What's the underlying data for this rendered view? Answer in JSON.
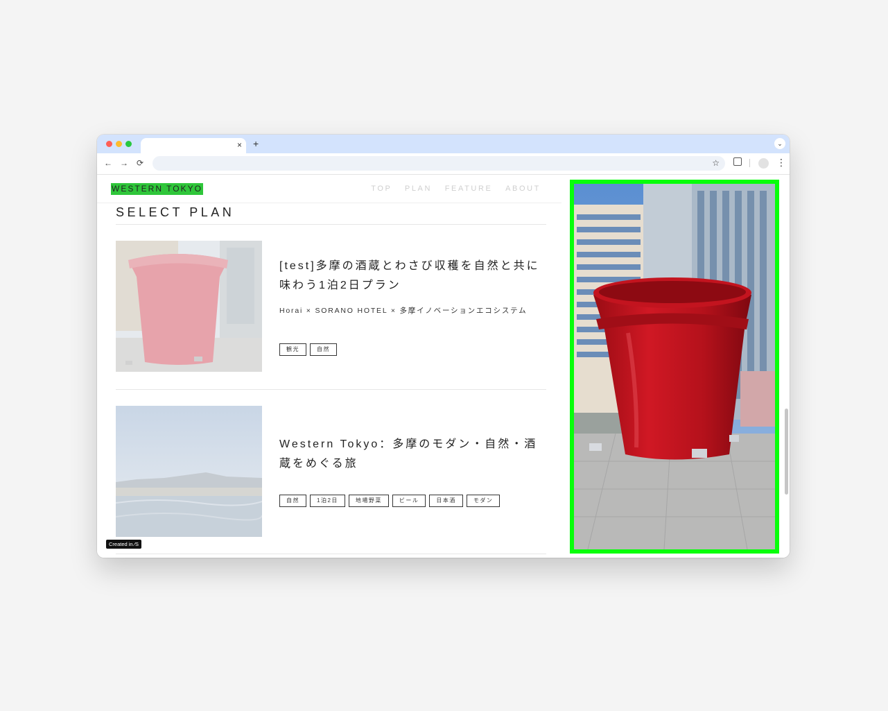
{
  "browser": {
    "tab_close": "×",
    "new_tab": "+",
    "search_tabs": "⌄",
    "back": "←",
    "forward": "→",
    "reload": "⟳",
    "bookmark": "☆",
    "menu": "⋮"
  },
  "site": {
    "logo": "WESTERN TOKYO",
    "nav": [
      "TOP",
      "PLAN",
      "FEATURE",
      "ABOUT"
    ],
    "section_title": "SELECT PLAN",
    "badge": "Created in ⁄S",
    "accent_color": "#2fc63a",
    "highlight_border": "#07ff0a"
  },
  "plans": [
    {
      "title": "[test]多摩の酒蔵とわさび収穫を自然と共に味わう1泊2日プラン",
      "subtitle": "Horai × SORANO HOTEL × 多摩イノベーションエコシステム",
      "tags": [
        "観光",
        "自然"
      ],
      "image": "red-pot-sculpture"
    },
    {
      "title": "Western Tokyo：多摩のモダン・自然・酒蔵をめぐる旅",
      "subtitle": "",
      "tags": [
        "自然",
        "1泊2日",
        "地場野菜",
        "ビール",
        "日本酒",
        "モダン"
      ],
      "image": "infinity-pool-city-view"
    }
  ],
  "hero": {
    "image": "red-pot-sculpture"
  }
}
